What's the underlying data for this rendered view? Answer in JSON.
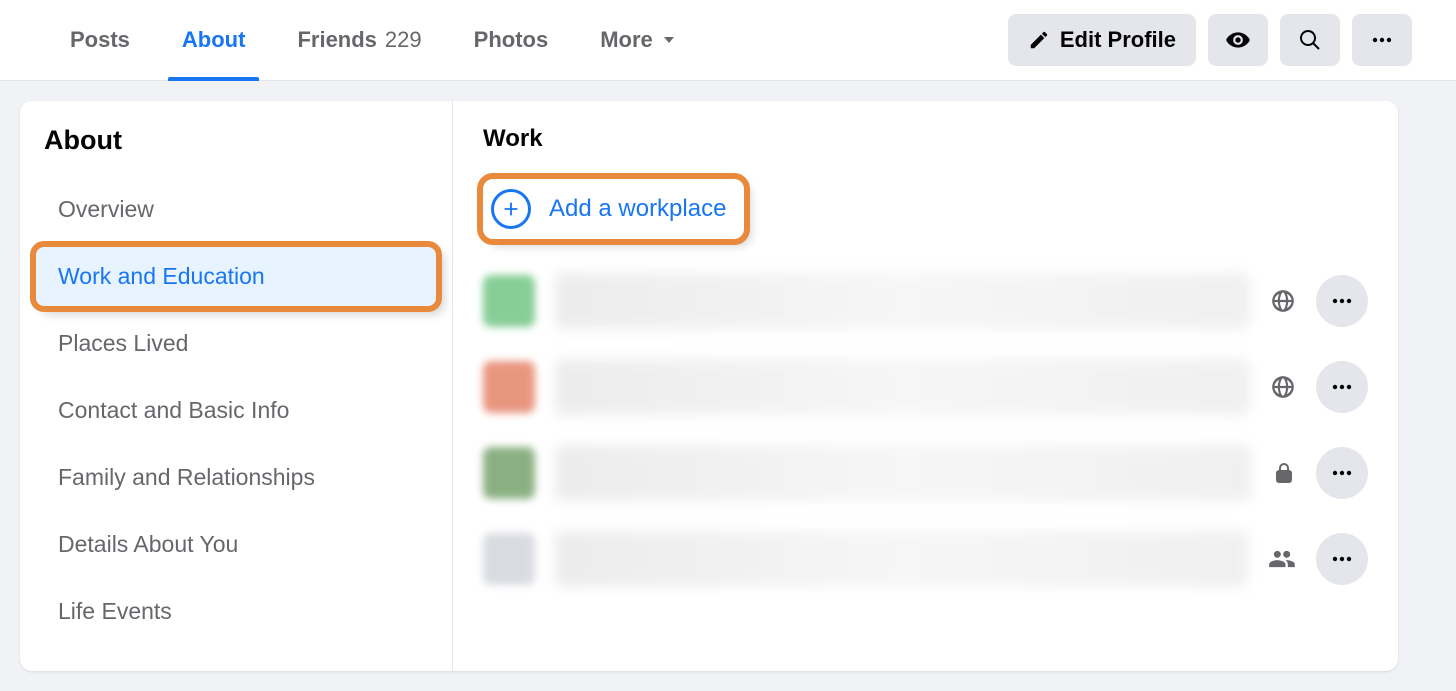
{
  "tabs": {
    "posts": "Posts",
    "about": "About",
    "friends": "Friends",
    "friends_count": "229",
    "photos": "Photos",
    "more": "More"
  },
  "actions": {
    "edit_profile": "Edit Profile"
  },
  "sidebar": {
    "title": "About",
    "items": [
      "Overview",
      "Work and Education",
      "Places Lived",
      "Contact and Basic Info",
      "Family and Relationships",
      "Details About You",
      "Life Events"
    ],
    "active_index": 1
  },
  "main": {
    "section_title": "Work",
    "add_label": "Add a workplace",
    "entries": [
      {
        "privacy": "public",
        "avatar_color": "#53b96a"
      },
      {
        "privacy": "public",
        "avatar_color": "#e06a4a"
      },
      {
        "privacy": "only-me",
        "avatar_color": "#5a8f4e"
      },
      {
        "privacy": "friends",
        "avatar_color": "#c9cdd4"
      }
    ]
  },
  "highlight": {
    "side_item": true,
    "add_row": true
  }
}
